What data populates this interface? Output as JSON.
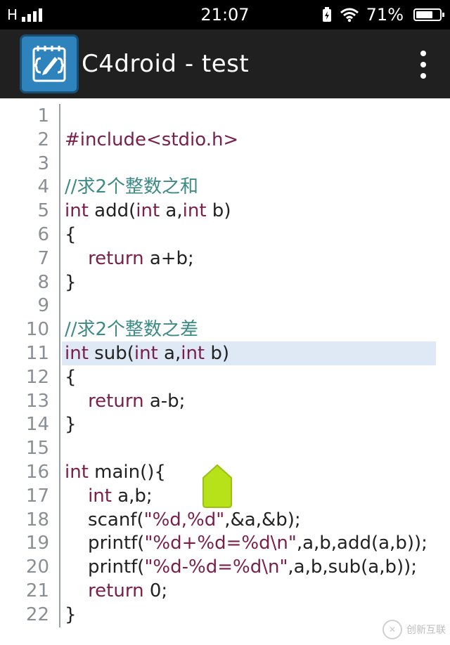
{
  "status_bar": {
    "network": "H",
    "time": "21:07",
    "battery": "71%",
    "battery_level": 0.71
  },
  "app_bar": {
    "title": "C4droid - test",
    "logo_icon": "notepad-code-icon",
    "menu_icon": "overflow-menu-icon"
  },
  "editor": {
    "current_line": 11,
    "lines": [
      {
        "n": "1",
        "text": ""
      },
      {
        "n": "2",
        "text": "#include<stdio.h>"
      },
      {
        "n": "3",
        "text": ""
      },
      {
        "n": "4",
        "text": "//求2个整数之和"
      },
      {
        "n": "5",
        "text": "int add(int a,int b)"
      },
      {
        "n": "6",
        "text": "{"
      },
      {
        "n": "7",
        "text": "    return a+b;"
      },
      {
        "n": "8",
        "text": "}"
      },
      {
        "n": "9",
        "text": ""
      },
      {
        "n": "10",
        "text": "//求2个整数之差"
      },
      {
        "n": "11",
        "text": "int sub(int a,int b)"
      },
      {
        "n": "12",
        "text": "{"
      },
      {
        "n": "13",
        "text": "    return a-b;"
      },
      {
        "n": "14",
        "text": "}"
      },
      {
        "n": "15",
        "text": ""
      },
      {
        "n": "16",
        "text": "int main(){"
      },
      {
        "n": "17",
        "text": "    int a,b;"
      },
      {
        "n": "18",
        "text": "    scanf(\"%d,%d\",&a,&b);"
      },
      {
        "n": "19",
        "text": "    printf(\"%d+%d=%d\\n\",a,b,add(a,b));"
      },
      {
        "n": "20",
        "text": "    printf(\"%d-%d=%d\\n\",a,b,sub(a,b));"
      },
      {
        "n": "21",
        "text": "    return 0;"
      },
      {
        "n": "22",
        "text": "}"
      }
    ]
  },
  "watermark": {
    "text": "创新互联"
  },
  "colors": {
    "statusbar_bg": "#000000",
    "appbar_bg": "#202020",
    "logo_bg": "#2f83bd",
    "keyword": "#7a1f4a",
    "comment": "#3c8a86",
    "current_line_bg": "#dfe9f5",
    "handle": "#b7e21a"
  }
}
